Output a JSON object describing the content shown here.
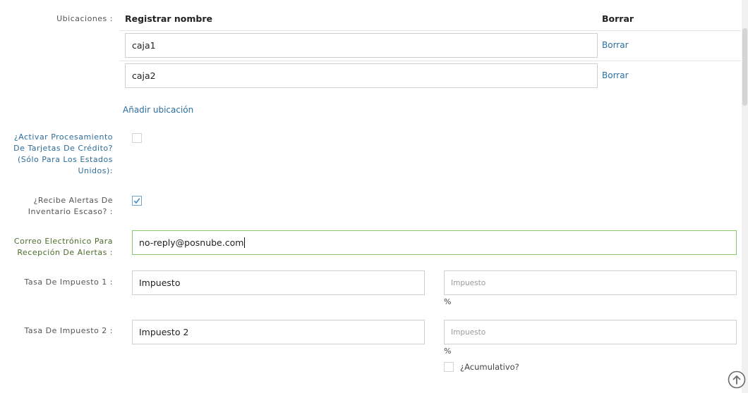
{
  "locations": {
    "label": "Ubicaciones :",
    "column_name": "Registrar nombre",
    "column_delete": "Borrar",
    "rows": [
      {
        "name": "caja1",
        "delete_label": "Borrar"
      },
      {
        "name": "caja2",
        "delete_label": "Borrar"
      }
    ],
    "add_label": "Añadir ubicación"
  },
  "credit_card": {
    "label_line1": "¿Activar Procesamiento",
    "label_line2": "De Tarjetas De Crédito?",
    "label_line3": "(Sólo Para Los Estados",
    "label_line4": "Unidos):",
    "checked": false
  },
  "low_stock_alerts": {
    "label_line1": "¿Recibe Alertas De",
    "label_line2": "Inventario Escaso? :",
    "checked": true
  },
  "alert_email": {
    "label_line1": "Correo Electrónico Para",
    "label_line2": "Recepción De Alertas :",
    "value": "no-reply@posnube.com"
  },
  "tax1": {
    "label": "Tasa De Impuesto 1 :",
    "name": "Impuesto",
    "rate_placeholder": "Impuesto",
    "percent_symbol": "%"
  },
  "tax2": {
    "label": "Tasa De Impuesto 2 :",
    "name": "Impuesto 2",
    "rate_placeholder": "Impuesto",
    "percent_symbol": "%",
    "cumulative_label": "¿Acumulativo?",
    "cumulative_checked": false
  },
  "icons": {
    "scroll_to_top": "arrow-up-circle-icon",
    "checkmark": "check-icon"
  },
  "colors": {
    "link": "#2a6f9e",
    "focus_border": "#8cc56b",
    "checkbox_check": "#3b8fd0"
  }
}
